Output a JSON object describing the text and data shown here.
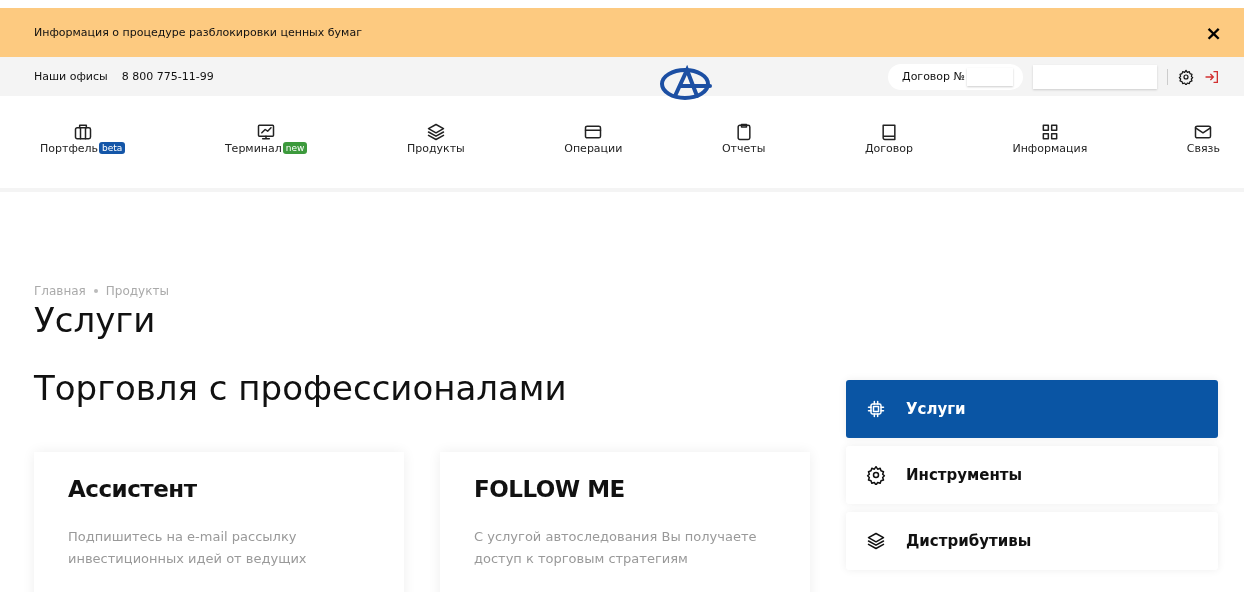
{
  "banner": {
    "text": "Информация о процедуре разблокировки ценных бумаг",
    "close": "×"
  },
  "topbar": {
    "offices": "Наши офисы",
    "phone": "8 800 775-11-99",
    "contract_label": "Договор №"
  },
  "nav": [
    {
      "kind": "briefcase",
      "label": "Портфель",
      "badge": {
        "text": "beta",
        "color": "#1456a8"
      }
    },
    {
      "kind": "monitor",
      "label": "Терминал",
      "badge": {
        "text": "new",
        "color": "#3d9a3d"
      }
    },
    {
      "kind": "layers",
      "label": "Продукты"
    },
    {
      "kind": "card",
      "label": "Операции"
    },
    {
      "kind": "clipboard",
      "label": "Отчеты"
    },
    {
      "kind": "book",
      "label": "Договор"
    },
    {
      "kind": "grid",
      "label": "Информация"
    },
    {
      "kind": "mail",
      "label": "Связь"
    }
  ],
  "breadcrumbs": [
    "Главная",
    "Продукты"
  ],
  "page_title": "Услуги",
  "section_title": "Торговля с профессионалами",
  "cards": [
    {
      "title": "Ассистент",
      "text": "Подпишитесь на e-mail рассылку инвестиционных идей от ведущих"
    },
    {
      "title": "FOLLOW ME",
      "text": "С услугой автоследования Вы получаете доступ к торговым стратегиям"
    }
  ],
  "sidebar": [
    {
      "kind": "chip",
      "label": "Услуги",
      "selected": true
    },
    {
      "kind": "gear",
      "label": "Инструменты",
      "selected": false
    },
    {
      "kind": "layers",
      "label": "Дистрибутивы",
      "selected": false
    }
  ]
}
